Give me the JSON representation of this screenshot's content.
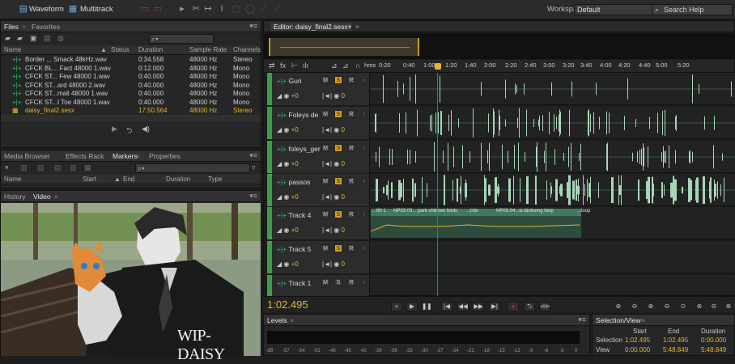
{
  "top": {
    "waveform_label": "Waveform",
    "multitrack_label": "Multitrack",
    "workspace_label": "Workspace:",
    "workspace_value": "Default",
    "search_placeholder": "Search Help"
  },
  "files_panel": {
    "tabs": [
      "Files",
      "Favorites"
    ],
    "columns": [
      "Name",
      "Status",
      "Duration",
      "Sample Rate",
      "Channels"
    ],
    "rows": [
      {
        "name": "Border ... Smack 48kHz.wav",
        "duration": "0:34.558",
        "rate": "48000 Hz",
        "channels": "Stereo"
      },
      {
        "name": "CFCK BL... Fact 48000 1.wav",
        "duration": "0:12.000",
        "rate": "48000 Hz",
        "channels": "Mono"
      },
      {
        "name": "CFCK ST... Few 48000 1.wav",
        "duration": "0:40.000",
        "rate": "48000 Hz",
        "channels": "Mono"
      },
      {
        "name": "CFCK ST...ard 48000 2.wav",
        "duration": "0:40.000",
        "rate": "48000 Hz",
        "channels": "Mono"
      },
      {
        "name": "CFCK ST...mall 48000 1.wav",
        "duration": "0:40.000",
        "rate": "48000 Hz",
        "channels": "Mono"
      },
      {
        "name": "CFCK ST...I Toe 48000 1.wav",
        "duration": "0:40.000",
        "rate": "48000 Hz",
        "channels": "Mono"
      },
      {
        "name": "daisy_final2.sesx",
        "duration": "17:50.564",
        "rate": "48000 Hz",
        "channels": "Stereo",
        "selected": true
      }
    ]
  },
  "markers_panel": {
    "tabs": [
      "Media Browser",
      "Effects Rack",
      "Markers",
      "Properties"
    ],
    "columns": [
      "Name",
      "Start",
      "End",
      "Duration",
      "Type"
    ]
  },
  "video_panel": {
    "tabs": [
      "History",
      "Video"
    ],
    "caption": "WIP- DAISY"
  },
  "editor": {
    "tab_label": "Editor: daisy_final2.sesx",
    "ruler": [
      "hms",
      "0:20",
      "0:40",
      "1:00",
      "1:20",
      "1:40",
      "2:00",
      "2:20",
      "2:40",
      "3:00",
      "3:20",
      "3:40",
      "4:00",
      "4:20",
      "4:40",
      "5:00",
      "5:20"
    ],
    "time_display": "1:02.495",
    "tracks": [
      {
        "name": "Guri",
        "vol": "+0",
        "pan": "0",
        "m": "M",
        "s": "S",
        "r": "R",
        "content": "wave-sparse"
      },
      {
        "name": "Foleys de",
        "vol": "+0",
        "pan": "0",
        "m": "M",
        "s": "S",
        "r": "R",
        "content": "wave"
      },
      {
        "name": "foleys_ger",
        "vol": "+0",
        "pan": "0",
        "m": "M",
        "s": "S",
        "r": "R",
        "content": "wave"
      },
      {
        "name": "passos",
        "vol": "+0",
        "pan": "0",
        "m": "M",
        "s": "S",
        "r": "R",
        "content": "wave-dense"
      },
      {
        "name": "Track 4",
        "vol": "+0",
        "pan": "0",
        "m": "M",
        "s": "S",
        "r": "R",
        "content": "clips"
      },
      {
        "name": "Track 5",
        "vol": "+0",
        "pan": "0",
        "m": "M",
        "s": "S",
        "r": "R",
        "content": "empty"
      },
      {
        "name": "Track 1",
        "vol": "+0",
        "pan": "0",
        "m": "M",
        "s": "S",
        "r": "R",
        "content": "empty"
      }
    ],
    "clips": [
      "...00 1",
      "NP03 03... park children birds",
      "...irds",
      "NP03 04...ts birdsong loop",
      "...loop"
    ]
  },
  "levels_panel": {
    "tab": "Levels",
    "scale": [
      "dB",
      "-57",
      "-54",
      "-51",
      "-48",
      "-45",
      "-42",
      "-39",
      "-36",
      "-33",
      "-30",
      "-27",
      "-24",
      "-21",
      "-18",
      "-15",
      "-12",
      "-9",
      "-6",
      "-3",
      "0"
    ]
  },
  "selection_panel": {
    "tab": "Selection/View",
    "columns": [
      "Start",
      "End",
      "Duration"
    ],
    "rows": [
      {
        "label": "Selection",
        "start": "1:02.495",
        "end": "1:02.495",
        "duration": "0:00.000"
      },
      {
        "label": "View",
        "start": "0:00.000",
        "end": "5:48.849",
        "duration": "5:48.849"
      }
    ]
  },
  "colors": {
    "accent": "#e8b530",
    "track_green": "#3f9d4a",
    "playhead": "#d23c3c",
    "waveform": "#a9d6b8"
  }
}
